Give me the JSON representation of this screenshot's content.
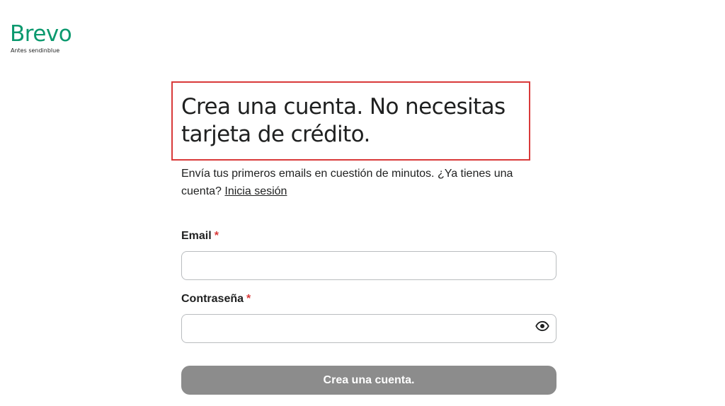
{
  "brand": {
    "name": "Brevo",
    "tagline": "Antes sendinblue",
    "color": "#0b996e"
  },
  "heading": {
    "line1": "Crea una cuenta. No necesitas",
    "line2": "tarjeta de crédito."
  },
  "highlight_color": "#d93a3a",
  "intro": {
    "text": "Envía tus primeros emails en cuestión de minutos. ¿Ya tienes una cuenta? ",
    "login_link": "Inicia sesión"
  },
  "form": {
    "email": {
      "label": "Email",
      "required_mark": "*",
      "value": "",
      "placeholder": ""
    },
    "password": {
      "label": "Contraseña",
      "required_mark": "*",
      "value": "",
      "placeholder": "",
      "toggle_icon": "eye-icon"
    },
    "submit_label": "Crea una cuenta."
  },
  "colors": {
    "text": "#1f2020",
    "required": "#d93a3a",
    "input_border": "#b9bcbf",
    "button_disabled": "#8c8c8c"
  }
}
